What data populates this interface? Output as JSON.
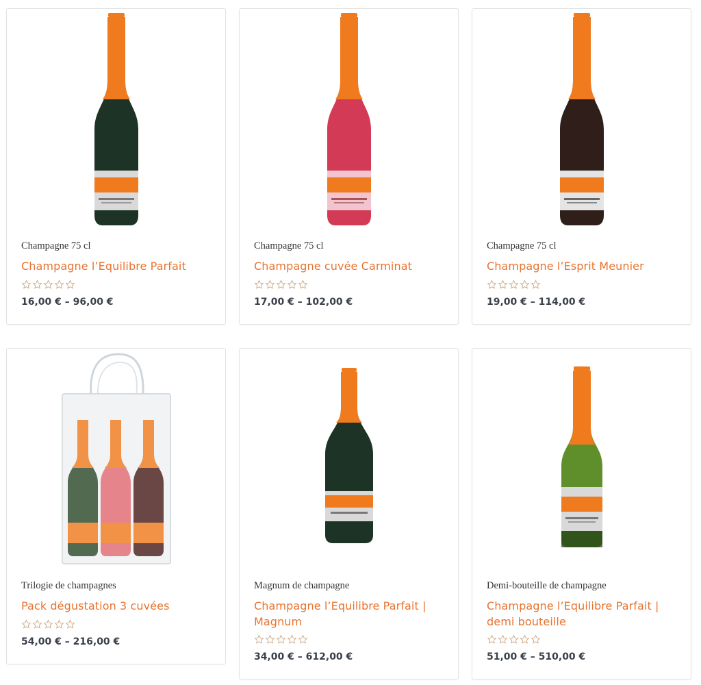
{
  "products": [
    {
      "category": "Champagne 75 cl",
      "title": "Champagne l’Equilibre Parfait",
      "rating": 0,
      "price": "16,00 € – 96,00 €"
    },
    {
      "category": "Champagne 75 cl",
      "title": "Champagne cuvée Carminat",
      "rating": 0,
      "price": "17,00 € – 102,00 €"
    },
    {
      "category": "Champagne 75 cl",
      "title": "Champagne l’Esprit Meunier",
      "rating": 0,
      "price": "19,00 € – 114,00 €"
    },
    {
      "category": "Trilogie de champagnes",
      "title": "Pack dégustation 3 cuvées",
      "rating": 0,
      "price": "54,00 € – 216,00 €"
    },
    {
      "category": "Magnum de champagne",
      "title_lines": [
        "Champagne l’Equilibre Parfait |",
        "Magnum"
      ],
      "rating": 0,
      "price": "34,00 € – 612,00 €"
    },
    {
      "category": "Demi-bouteille de champagne",
      "title_lines": [
        "Champagne l’Equilibre Parfait |",
        "demi bouteille"
      ],
      "rating": 0,
      "price": "51,00 € – 510,00 €"
    }
  ],
  "colors": {
    "accent": "#e8732e",
    "price": "#3a3f4a",
    "star": "#c8a27a",
    "capsule": "#f07a1e",
    "bottle_green": "#1d3325",
    "bottle_rose": "#d23a55",
    "bottle_brown": "#2f1e1a",
    "bottle_light_green": "#5e8f2a"
  },
  "icons": {
    "star": "star-outline-icon"
  }
}
